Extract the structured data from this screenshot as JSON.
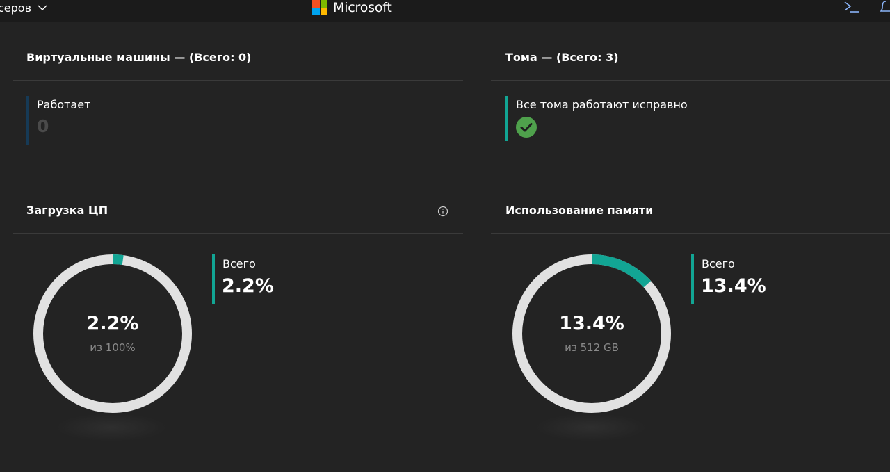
{
  "topbar": {
    "left_label": "серов",
    "brand": "Microsoft",
    "logo_colors": [
      "#f25022",
      "#7fba00",
      "#00a4ef",
      "#ffb900"
    ]
  },
  "vm_panel": {
    "title": "Виртуальные машины — (Всего: 0)",
    "running_label": "Работает",
    "running_value": "0"
  },
  "volumes_panel": {
    "title": "Тома — (Всего: 3)",
    "status_label": "Все тома работают исправно"
  },
  "cpu_panel": {
    "title": "Загрузка ЦП",
    "donut_value": "2.2%",
    "donut_sub": "из 100%",
    "legend_label": "Всего",
    "legend_value": "2.2%",
    "percent": 2.2
  },
  "memory_panel": {
    "title": "Использование памяти",
    "donut_value": "13.4%",
    "donut_sub": "из 512 GB",
    "legend_label": "Всего",
    "legend_value": "13.4%",
    "percent": 13.4
  },
  "colors": {
    "accent": "#12a594",
    "ring_track": "#e1e1e1",
    "success": "#4fa14c",
    "muted_bar": "#163a56"
  }
}
